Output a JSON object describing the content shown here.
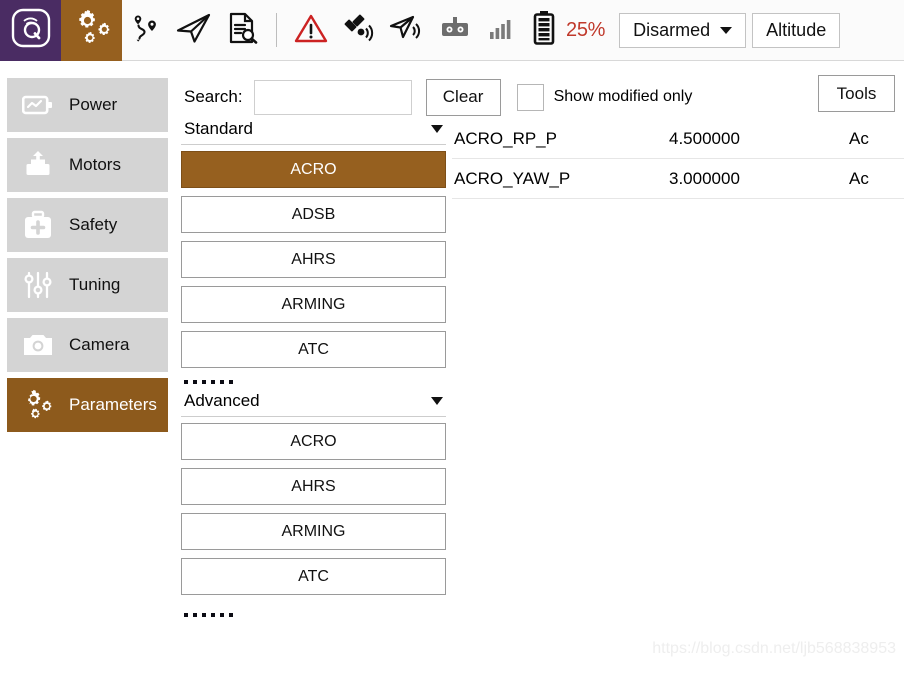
{
  "toolbar": {
    "logo_icon": "qgroundcontrol-logo-icon",
    "gear_icon": "gears-icon",
    "icons": [
      {
        "name": "plan-waypoints-icon"
      },
      {
        "name": "fly-paper-plane-icon"
      },
      {
        "name": "analyze-document-search-icon"
      },
      {
        "name": "warning-triangle-icon"
      },
      {
        "name": "satellite-icon"
      },
      {
        "name": "vehicle-paper-plane-signal-icon"
      },
      {
        "name": "rc-controller-icon"
      },
      {
        "name": "signal-bars-icon"
      },
      {
        "name": "battery-icon"
      }
    ],
    "battery_percent": "25%",
    "arm_state": "Disarmed",
    "flight_mode": "Altitude"
  },
  "sidebar": {
    "items": [
      {
        "label": "Power",
        "icon": "battery-power-icon",
        "active": false
      },
      {
        "label": "Motors",
        "icon": "motor-icon",
        "active": false
      },
      {
        "label": "Safety",
        "icon": "first-aid-kit-icon",
        "active": false
      },
      {
        "label": "Tuning",
        "icon": "sliders-icon",
        "active": false
      },
      {
        "label": "Camera",
        "icon": "camera-icon",
        "active": false
      },
      {
        "label": "Parameters",
        "icon": "gears-icon",
        "active": true
      }
    ]
  },
  "controls": {
    "search_label": "Search:",
    "search_value": "",
    "search_placeholder": "",
    "clear_label": "Clear",
    "show_modified_label": "Show modified only",
    "show_modified_checked": false,
    "tools_label": "Tools"
  },
  "groups": {
    "standard": {
      "header": "Standard",
      "items": [
        {
          "label": "ACRO",
          "selected": true
        },
        {
          "label": "ADSB",
          "selected": false
        },
        {
          "label": "AHRS",
          "selected": false
        },
        {
          "label": "ARMING",
          "selected": false
        },
        {
          "label": "ATC",
          "selected": false
        }
      ],
      "more_dots": 6
    },
    "advanced": {
      "header": "Advanced",
      "items": [
        {
          "label": "ACRO",
          "selected": false
        },
        {
          "label": "AHRS",
          "selected": false
        },
        {
          "label": "ARMING",
          "selected": false
        },
        {
          "label": "ATC",
          "selected": false
        }
      ],
      "more_dots": 6
    }
  },
  "parameters": {
    "rows": [
      {
        "name": "ACRO_RP_P",
        "value": "4.500000",
        "description": "Ac"
      },
      {
        "name": "ACRO_YAW_P",
        "value": "3.000000",
        "description": "Ac"
      }
    ]
  },
  "watermark": "https://blog.csdn.net/ljb568838953",
  "colors": {
    "brand_purple": "#4a2c63",
    "accent_brown": "#96601f",
    "sidebar_active": "#8d5a1c",
    "sidebar_item": "#d4d4d4",
    "battery_red": "#c0392b"
  }
}
